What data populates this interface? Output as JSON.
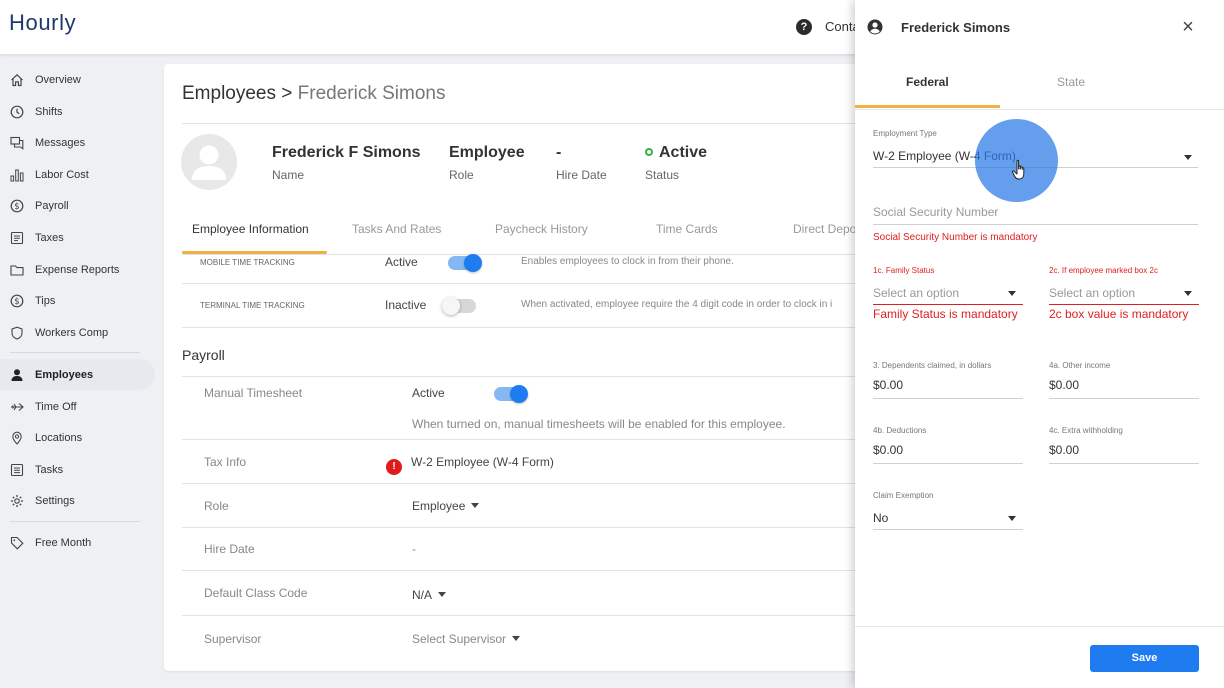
{
  "app": {
    "logo": "Hourly",
    "help_icon": "?",
    "contact_label": "Conta"
  },
  "sidebar": {
    "items": [
      {
        "label": "Overview",
        "icon": "home-icon"
      },
      {
        "label": "Shifts",
        "icon": "clock-icon"
      },
      {
        "label": "Messages",
        "icon": "chat-icon"
      },
      {
        "label": "Labor Cost",
        "icon": "bar-chart-icon"
      },
      {
        "label": "Payroll",
        "icon": "dollar-circle-icon"
      },
      {
        "label": "Taxes",
        "icon": "document-icon"
      },
      {
        "label": "Expense Reports",
        "icon": "folder-icon"
      },
      {
        "label": "Tips",
        "icon": "dollar-coin-icon"
      },
      {
        "label": "Workers Comp",
        "icon": "shield-icon"
      },
      {
        "label": "Employees",
        "icon": "person-icon",
        "active": true
      },
      {
        "label": "Time Off",
        "icon": "plane-icon"
      },
      {
        "label": "Locations",
        "icon": "location-pin-icon"
      },
      {
        "label": "Tasks",
        "icon": "list-icon"
      },
      {
        "label": "Settings",
        "icon": "gear-icon"
      },
      {
        "label": "Free Month",
        "icon": "tag-icon"
      }
    ]
  },
  "main": {
    "breadcrumb": {
      "root": "Employees >",
      "current": "Frederick Simons"
    },
    "header": {
      "name": "Frederick F Simons",
      "name_label": "Name",
      "role": "Employee",
      "role_label": "Role",
      "hire_date": "-",
      "hire_date_label": "Hire Date",
      "status": "Active",
      "status_label": "Status"
    },
    "tabs": [
      "Employee Information",
      "Tasks And Rates",
      "Paycheck History",
      "Time Cards",
      "Direct Depo"
    ],
    "time_tracking": [
      {
        "label": "MOBILE TIME TRACKING",
        "status": "Active",
        "enabled": true,
        "description": "Enables employees to clock in from their phone."
      },
      {
        "label": "TERMINAL TIME TRACKING",
        "status": "Inactive",
        "enabled": false,
        "description": "When activated, employee require the 4 digit code in order to clock in i"
      }
    ],
    "payroll": {
      "title": "Payroll",
      "manual_timesheet": {
        "label": "Manual Timesheet",
        "status": "Active",
        "enabled": true,
        "description": "When turned on, manual timesheets will be enabled for this employee."
      },
      "tax_info": {
        "label": "Tax Info",
        "value": "W-2 Employee (W-4 Form)",
        "alert_icon": "!"
      },
      "role": {
        "label": "Role",
        "value": "Employee"
      },
      "hire_date": {
        "label": "Hire Date",
        "value": "-"
      },
      "default_class_code": {
        "label": "Default Class Code",
        "value": "N/A"
      },
      "supervisor": {
        "label": "Supervisor",
        "value": "Select Supervisor"
      }
    }
  },
  "panel": {
    "title": "Frederick Simons",
    "close_icon": "×",
    "tabs": [
      "Federal",
      "State"
    ],
    "employment_type": {
      "label": "Employment Type",
      "value": "W-2 Employee (W-4 Form)"
    },
    "ssn": {
      "placeholder": "Social Security Number",
      "error": "Social Security Number is mandatory"
    },
    "family_status": {
      "label": "1c. Family Status",
      "placeholder": "Select an option",
      "error": "Family Status is mandatory"
    },
    "box_2c": {
      "label": "2c. If employee marked box 2c",
      "placeholder": "Select an option",
      "error": "2c box value is mandatory"
    },
    "dependents": {
      "label": "3. Dependents claimed, in dollars",
      "value": "$0.00"
    },
    "other_income": {
      "label": "4a. Other income",
      "value": "$0.00"
    },
    "deductions": {
      "label": "4b. Deductions",
      "value": "$0.00"
    },
    "extra_withholding": {
      "label": "4c. Extra withholding",
      "value": "$0.00"
    },
    "claim_exemption": {
      "label": "Claim Exemption",
      "value": "No"
    },
    "save_label": "Save"
  },
  "colors": {
    "accent": "#1f7cf0",
    "tab_underline": "#f0b042",
    "error": "#e02020",
    "active_status": "#2fb344",
    "brand": "#1d3b6a"
  }
}
